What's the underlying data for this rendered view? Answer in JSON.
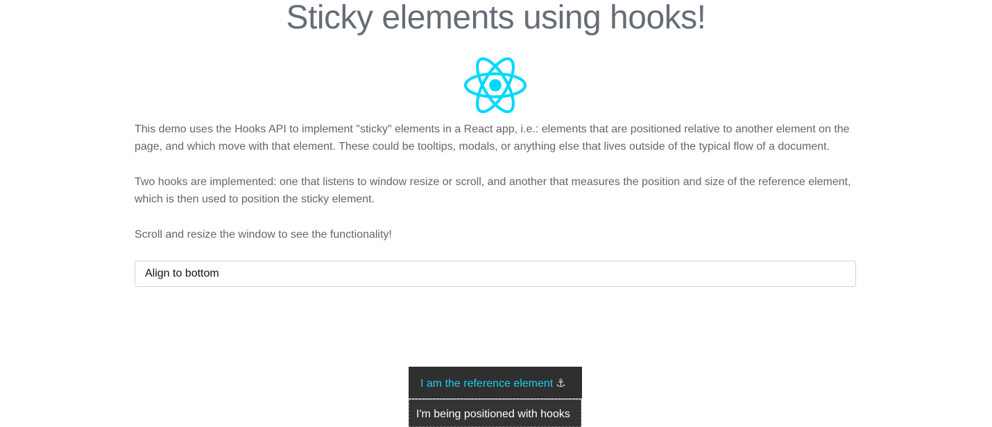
{
  "header": {
    "title": "Sticky elements using hooks!"
  },
  "logo": {
    "icon": "react-logo-icon",
    "color": "#00d8ff"
  },
  "intro": {
    "paragraphs": [
      "This demo uses the Hooks API to implement \"sticky\" elements in a React app, i.e.: elements that are positioned relative to another element on the page, and which move with that element. These could be tooltips, modals, or anything else that lives outside of the typical flow of a document.",
      "Two hooks are implemented: one that listens to window resize or scroll, and another that measures the position and size of the reference element, which is then used to position the sticky element.",
      "Scroll and resize the window to see the functionality!"
    ]
  },
  "alignment_select": {
    "selected": "Align to bottom"
  },
  "reference_element": {
    "label": "I am the reference element",
    "icon": "anchor-icon",
    "icon_glyph": "⚓",
    "label_color": "#1ccff0",
    "background": "#2f2f2f"
  },
  "sticky_element": {
    "label": "I'm being positioned with hooks"
  }
}
